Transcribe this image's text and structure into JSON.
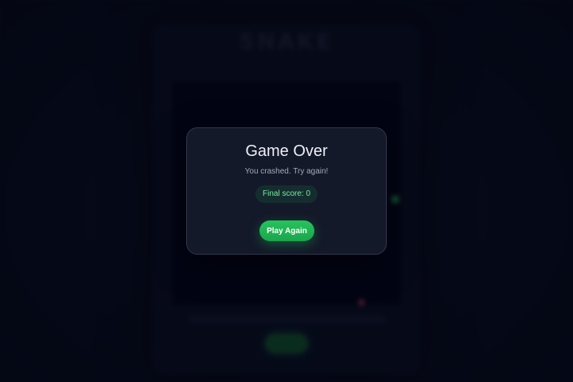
{
  "background": {
    "game_title": "SNAKE",
    "colors": {
      "page": "#080c1f",
      "board": "#03051a",
      "snake": "#1f8a46",
      "food": "#8a2a43"
    }
  },
  "modal": {
    "title": "Game Over",
    "message": "You crashed. Try again!",
    "score_label": "Final score: ",
    "score_value": "0",
    "play_again_label": "Play Again",
    "colors": {
      "accent": "#22c55e",
      "panel": "#161b2b"
    }
  }
}
